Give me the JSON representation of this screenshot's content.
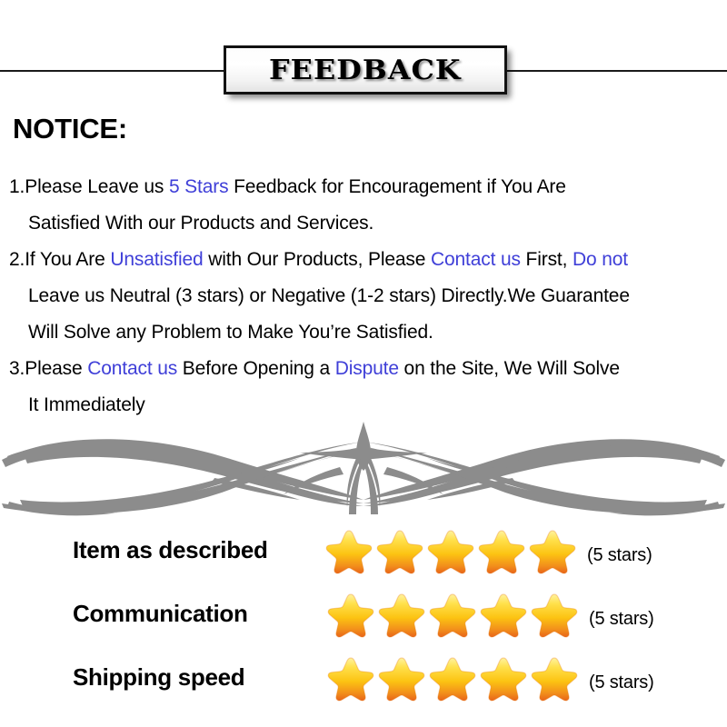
{
  "banner": {
    "title": "FEEDBACK"
  },
  "notice": {
    "heading": "NOTICE:",
    "highlight_color": "#3f3fd8",
    "lines": [
      {
        "type": "lead",
        "segments": [
          {
            "text": "1.Please Leave us  ",
            "highlight": false
          },
          {
            "text": "5 Stars",
            "highlight": true
          },
          {
            "text": "  Feedback for  Encouragement  if You Are",
            "highlight": false
          }
        ]
      },
      {
        "type": "indent",
        "segments": [
          {
            "text": "Satisfied With our Products and Services.",
            "highlight": false
          }
        ]
      },
      {
        "type": "lead",
        "segments": [
          {
            "text": "2.If You Are ",
            "highlight": false
          },
          {
            "text": "Unsatisfied",
            "highlight": true
          },
          {
            "text": " with Our Products, Please ",
            "highlight": false
          },
          {
            "text": "Contact us",
            "highlight": true
          },
          {
            "text": " First, ",
            "highlight": false
          },
          {
            "text": "Do not",
            "highlight": true
          }
        ]
      },
      {
        "type": "indent",
        "segments": [
          {
            "text": "Leave us Neutral (3 stars) or Negative (1-2 stars) Directly.We Guarantee",
            "highlight": false
          }
        ]
      },
      {
        "type": "indent",
        "segments": [
          {
            "text": "Will Solve any Problem to Make You’re  Satisfied.",
            "highlight": false
          }
        ]
      },
      {
        "type": "lead",
        "segments": [
          {
            "text": "3.Please ",
            "highlight": false
          },
          {
            "text": "Contact us",
            "highlight": true
          },
          {
            "text": " Before Opening a ",
            "highlight": false
          },
          {
            "text": "Dispute",
            "highlight": true
          },
          {
            "text": " on the Site, We Will Solve",
            "highlight": false
          }
        ]
      },
      {
        "type": "indent",
        "segments": [
          {
            "text": "It Immediately",
            "highlight": false
          }
        ]
      }
    ]
  },
  "divider": {
    "icon": "ornamental-flourish",
    "color": "#8c8c8c"
  },
  "ratings": {
    "star_colors": {
      "top": "#ffe866",
      "mid": "#ffc81e",
      "bottom": "#ef7f1c"
    },
    "rows": [
      {
        "label": "Item as described",
        "stars": 5,
        "count_label": "(5 stars)"
      },
      {
        "label": "Communication",
        "stars": 5,
        "count_label": "(5 stars)"
      },
      {
        "label": "Shipping speed",
        "stars": 5,
        "count_label": "(5 stars)"
      }
    ]
  }
}
